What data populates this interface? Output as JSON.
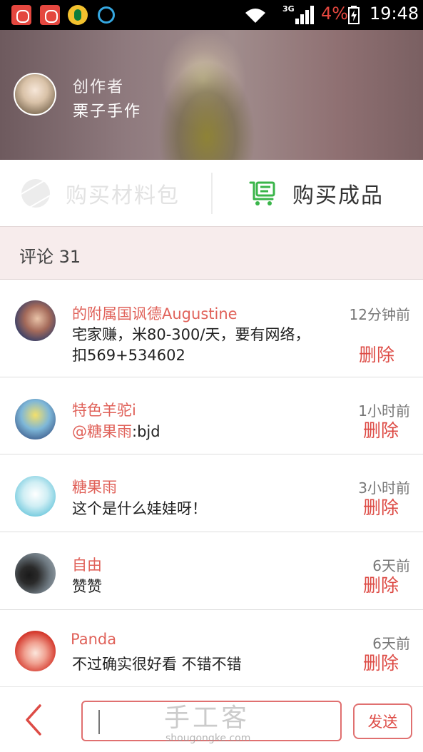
{
  "status_bar": {
    "network": "3G",
    "battery_percent": "4%",
    "time": "19:48"
  },
  "creator": {
    "role_label": "创作者",
    "name": "栗子手作"
  },
  "buy": {
    "kit_label": "购买材料包",
    "product_label": "购买成品"
  },
  "comments_header": {
    "label": "评论 31"
  },
  "comments": [
    {
      "name": "的附属国讽德Augustine",
      "text": "宅家赚，米80-300/天，要有网络，扣569+534602",
      "time": "12分钟前",
      "delete_label": "删除"
    },
    {
      "name": "特色羊驼i",
      "mention": "@糖果雨",
      "text": ":bjd",
      "time": "1小时前",
      "delete_label": "删除"
    },
    {
      "name": "糖果雨",
      "text": "这个是什么娃娃呀！",
      "time": "3小时前",
      "delete_label": "删除"
    },
    {
      "name": "自由",
      "text": "赞赞",
      "time": "6天前",
      "delete_label": "删除"
    },
    {
      "name": "Panda",
      "text": "不过确实很好看 不错不错",
      "time": "6天前",
      "delete_label": "删除"
    }
  ],
  "bottom_bar": {
    "send_label": "发送",
    "input_value": "",
    "watermark": "手工客",
    "watermark_url": "shougongke.com"
  },
  "colors": {
    "accent_red": "#dd4b45",
    "name_red": "#e0625a",
    "cart_green": "#3ab54a",
    "comments_header_bg": "#f7ecec"
  }
}
